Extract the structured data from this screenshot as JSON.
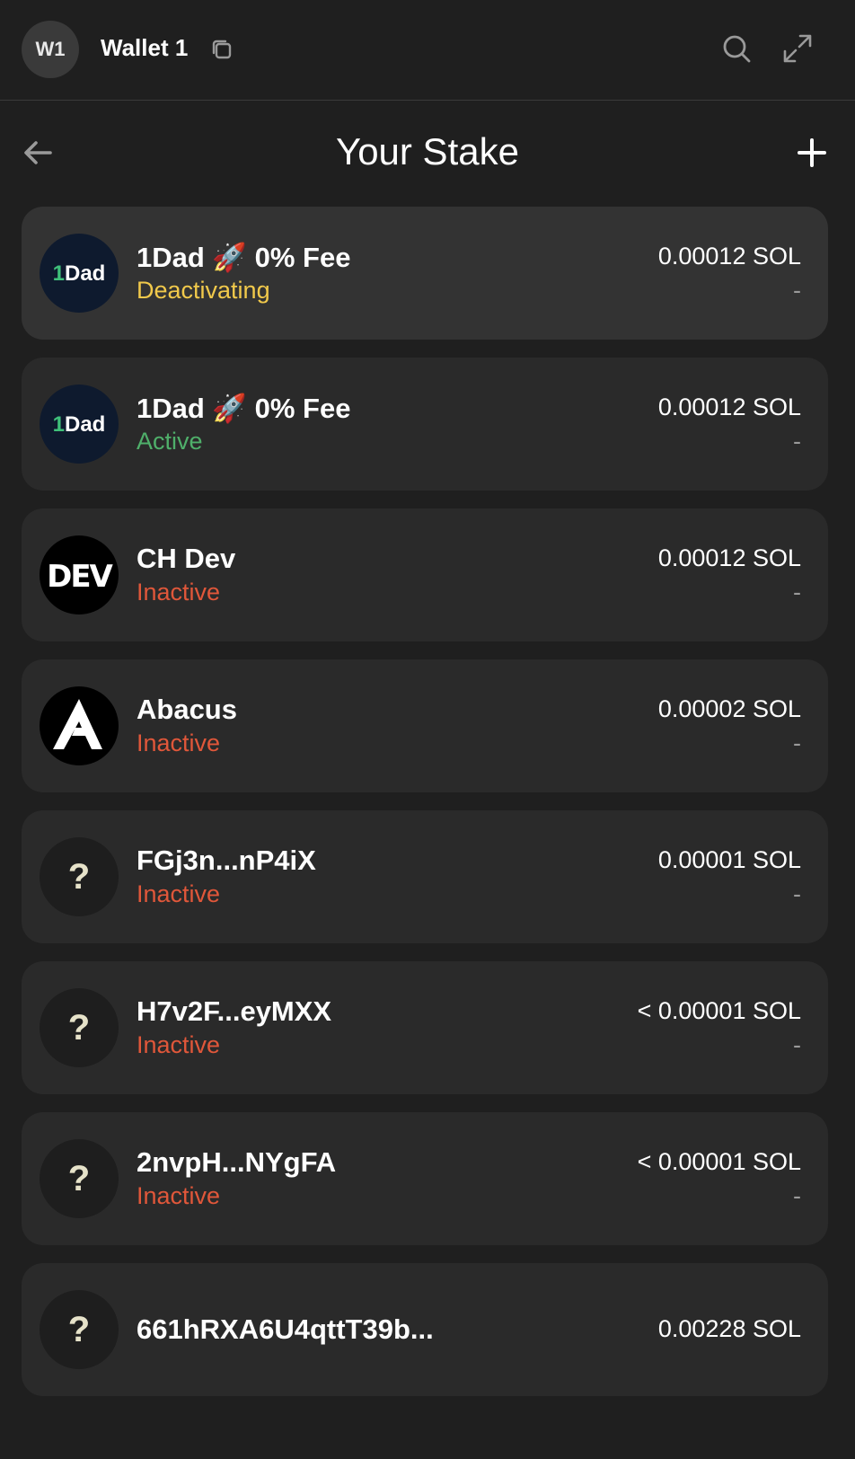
{
  "header": {
    "avatar_initials": "W1",
    "wallet_name": "Wallet 1"
  },
  "page": {
    "title": "Your Stake"
  },
  "colors": {
    "deactivating": "#f1c94b",
    "active": "#4faf6a",
    "inactive": "#e0573a"
  },
  "stakes": [
    {
      "name": "1Dad 🚀 0% Fee",
      "status": "Deactivating",
      "amount": "0.00012 SOL",
      "sub": "-",
      "logo": "1dad-logo",
      "logo_text": "1Dad"
    },
    {
      "name": "1Dad 🚀 0% Fee",
      "status": "Active",
      "amount": "0.00012 SOL",
      "sub": "-",
      "logo": "1dad-logo",
      "logo_text": "1Dad"
    },
    {
      "name": "CH Dev",
      "status": "Inactive",
      "amount": "0.00012 SOL",
      "sub": "-",
      "logo": "dev-logo",
      "logo_text": "DEV"
    },
    {
      "name": "Abacus",
      "status": "Inactive",
      "amount": "0.00002 SOL",
      "sub": "-",
      "logo": "abacus-logo"
    },
    {
      "name": "FGj3n...nP4iX",
      "status": "Inactive",
      "amount": "0.00001 SOL",
      "sub": "-",
      "logo": "question-icon",
      "logo_text": "?"
    },
    {
      "name": "H7v2F...eyMXX",
      "status": "Inactive",
      "amount": "< 0.00001 SOL",
      "sub": "-",
      "logo": "question-icon",
      "logo_text": "?"
    },
    {
      "name": "2nvpH...NYgFA",
      "status": "Inactive",
      "amount": "< 0.00001 SOL",
      "sub": "-",
      "logo": "question-icon",
      "logo_text": "?"
    },
    {
      "name": "661hRXA6U4qttT39b...",
      "amount": "0.00228 SOL",
      "logo": "question-icon",
      "logo_text": "?"
    }
  ]
}
